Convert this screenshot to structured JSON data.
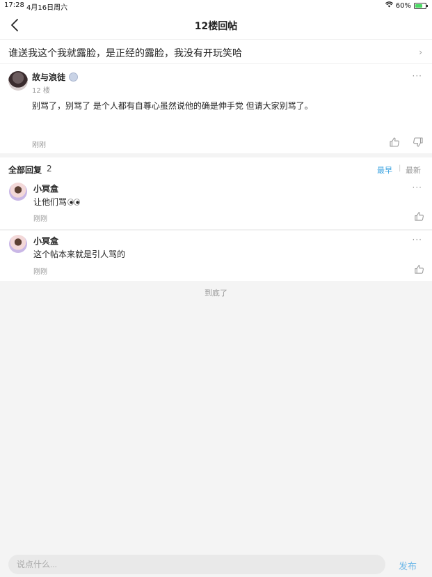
{
  "status_bar": {
    "time": "17:28",
    "date": "4月16日周六",
    "battery": "60%",
    "wifi_icon": "wifi-icon",
    "battery_icon": "battery-charging-icon"
  },
  "nav": {
    "title": "12楼回帖",
    "back_icon": "chevron-left-icon"
  },
  "thread_link": {
    "text": "谁送我这个我就露脸，是正经的露脸，我没有开玩笑哈",
    "chevron": "›"
  },
  "floor_post": {
    "author": "故与浪徒",
    "floor": "12 楼",
    "more": "···",
    "content": "别骂了，别骂了 是个人都有自尊心虽然说他的确是伸手党  但请大家别骂了。",
    "time": "刚刚"
  },
  "replies_header": {
    "label": "全部回复",
    "count": "2",
    "sort_earliest": "最早",
    "sort_sep": "|",
    "sort_latest": "最新",
    "active_color": "#3aa3e0"
  },
  "replies": [
    {
      "name": "小冥盒",
      "content": "让他们骂",
      "emoji": "eyes-emoji",
      "time": "刚刚",
      "more": "···"
    },
    {
      "name": "小冥盒",
      "content": "这个帖本来就是引人骂的",
      "time": "刚刚",
      "more": "···"
    }
  ],
  "end_text": "到底了",
  "bottom_bar": {
    "placeholder": "说点什么...",
    "publish": "发布",
    "publish_color": "#6fb8e8"
  }
}
